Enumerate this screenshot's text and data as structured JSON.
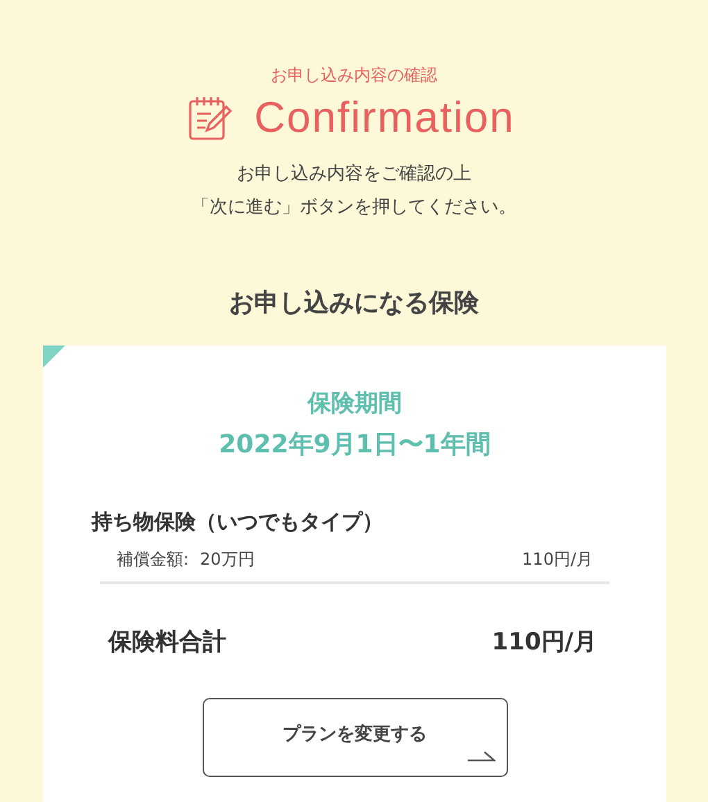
{
  "header": {
    "eyebrow": "お申し込み内容の確認",
    "title": "Confirmation",
    "instructions": [
      "お申し込み内容をご確認の上",
      "「次に進む」ボタンを押してください。"
    ]
  },
  "section_title": "お申し込みになる保険",
  "card": {
    "period_label": "保険期間",
    "period_value": "2022年9月1日〜1年間",
    "items": [
      {
        "name": "持ち物保険（いつでもタイプ）",
        "detail_label": "補償金額:",
        "detail_value": "20万円",
        "price": "110円/月"
      }
    ],
    "total_label": "保険料合計",
    "total_value": "110円/月",
    "change_button": "プランを変更する"
  }
}
